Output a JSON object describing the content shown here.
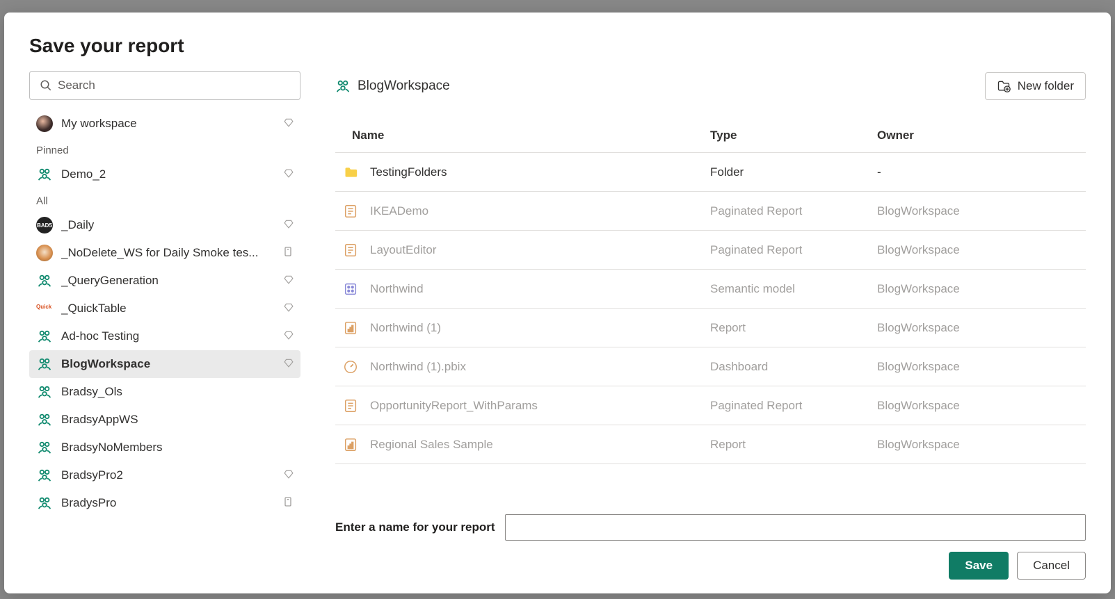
{
  "dialog": {
    "title": "Save your report",
    "search_placeholder": "Search"
  },
  "sidebar": {
    "my_workspace": "My workspace",
    "section_pinned": "Pinned",
    "section_all": "All",
    "items_pinned": [
      {
        "icon": "group",
        "label": "Demo_2",
        "badge": "diamond"
      }
    ],
    "items_all": [
      {
        "icon": "bw",
        "label": "_Daily",
        "badge": "diamond"
      },
      {
        "icon": "dog",
        "label": "_NoDelete_WS for Daily Smoke tes...",
        "badge": "share"
      },
      {
        "icon": "group",
        "label": "_QueryGeneration",
        "badge": "diamond"
      },
      {
        "icon": "qt",
        "label": "_QuickTable",
        "badge": "diamond"
      },
      {
        "icon": "group",
        "label": "Ad-hoc Testing",
        "badge": "diamond"
      },
      {
        "icon": "group",
        "label": "BlogWorkspace",
        "badge": "diamond",
        "selected": true
      },
      {
        "icon": "group",
        "label": "Bradsy_Ols",
        "badge": ""
      },
      {
        "icon": "group",
        "label": "BradsyAppWS",
        "badge": ""
      },
      {
        "icon": "group",
        "label": "BradsyNoMembers",
        "badge": ""
      },
      {
        "icon": "group",
        "label": "BradsyPro2",
        "badge": "diamond"
      },
      {
        "icon": "group",
        "label": "BradysPro",
        "badge": "share"
      }
    ]
  },
  "main": {
    "breadcrumb": "BlogWorkspace",
    "new_folder_label": "New folder",
    "columns": {
      "name": "Name",
      "type": "Type",
      "owner": "Owner"
    },
    "rows": [
      {
        "icon": "folder",
        "name": "TestingFolders",
        "type": "Folder",
        "owner": "-",
        "enabled": true
      },
      {
        "icon": "paginated",
        "name": "IKEADemo",
        "type": "Paginated Report",
        "owner": "BlogWorkspace",
        "enabled": false
      },
      {
        "icon": "paginated",
        "name": "LayoutEditor",
        "type": "Paginated Report",
        "owner": "BlogWorkspace",
        "enabled": false
      },
      {
        "icon": "dataset",
        "name": "Northwind",
        "type": "Semantic model",
        "owner": "BlogWorkspace",
        "enabled": false
      },
      {
        "icon": "report",
        "name": "Northwind (1)",
        "type": "Report",
        "owner": "BlogWorkspace",
        "enabled": false
      },
      {
        "icon": "dashboard",
        "name": "Northwind (1).pbix",
        "type": "Dashboard",
        "owner": "BlogWorkspace",
        "enabled": false
      },
      {
        "icon": "paginated",
        "name": "OpportunityReport_WithParams",
        "type": "Paginated Report",
        "owner": "BlogWorkspace",
        "enabled": false
      },
      {
        "icon": "report",
        "name": "Regional Sales Sample",
        "type": "Report",
        "owner": "BlogWorkspace",
        "enabled": false
      }
    ],
    "name_input_label": "Enter a name for your report",
    "name_input_value": "",
    "save_label": "Save",
    "cancel_label": "Cancel"
  }
}
